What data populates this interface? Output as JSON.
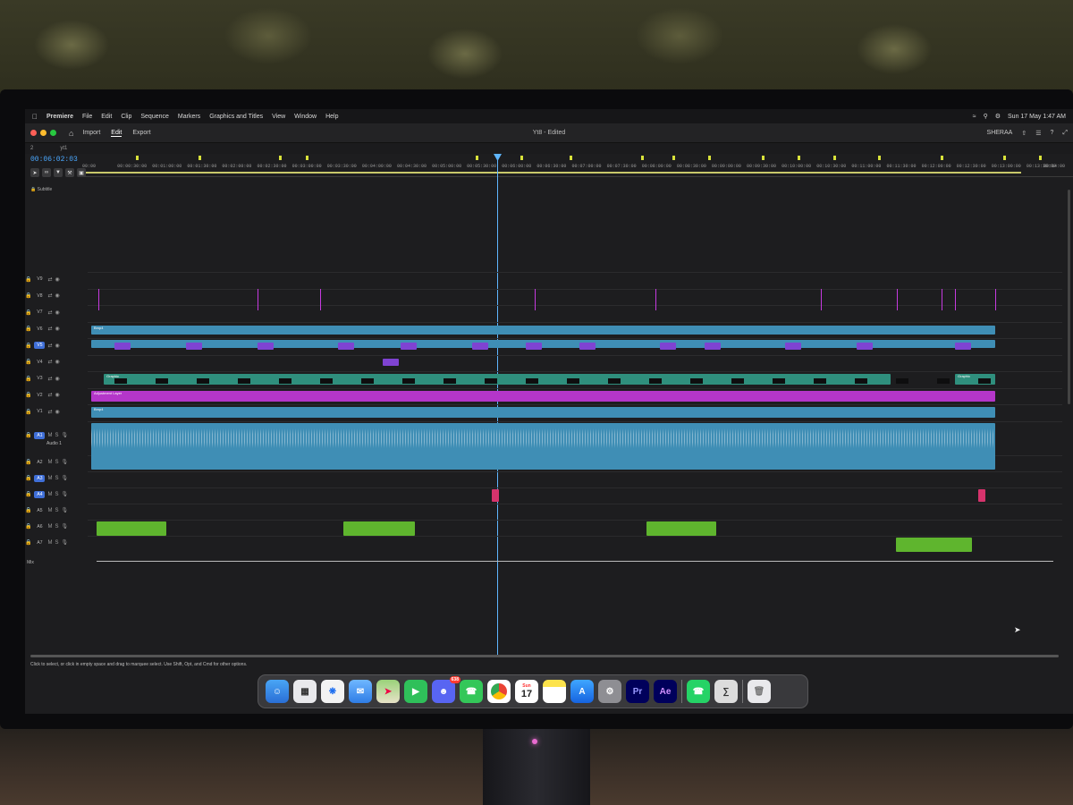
{
  "menubar": {
    "app": "Premiere",
    "items": [
      "File",
      "Edit",
      "Clip",
      "Sequence",
      "Markers",
      "Graphics and Titles",
      "View",
      "Window",
      "Help"
    ],
    "date_time": "Sun 17 May  1:47 AM",
    "user": "SHERAA"
  },
  "toolbar": {
    "workspaces": [
      "Import",
      "Edit",
      "Export"
    ],
    "active_workspace": "Edit",
    "document_title": "Yt8 - Edited"
  },
  "sequence_tabs": [
    "2",
    "yt1"
  ],
  "timecode": "00:06:02:03",
  "ruler_ticks": [
    "00:00",
    "00:00:30:00",
    "00:01:00:00",
    "00:01:30:00",
    "00:02:00:00",
    "00:02:30:00",
    "00:03:00:00",
    "00:03:30:00",
    "00:04:00:00",
    "00:04:30:00",
    "00:05:00:00",
    "00:05:30:00",
    "00:06:00:00",
    "00:06:30:00",
    "00:07:00:00",
    "00:07:30:00",
    "00:08:00:00",
    "00:08:30:00",
    "00:09:00:00",
    "00:09:30:00",
    "00:10:00:00",
    "00:10:30:00",
    "00:11:00:00",
    "00:11:30:00",
    "00:12:00:00",
    "00:12:30:00",
    "00:13:00:00",
    "00:13:30:00",
    "00:14:00"
  ],
  "subtitle_track": "Subtitle",
  "video_tracks": [
    "V9",
    "V8",
    "V7",
    "V6",
    "V5",
    "V4",
    "V3",
    "V2",
    "V1"
  ],
  "selected_video_target": "V5",
  "audio_tracks": [
    "A1",
    "A2",
    "A3",
    "A4",
    "A5",
    "A6",
    "A7"
  ],
  "audio1_label": "Audio 1",
  "mix_label": "Mix",
  "clip_labels": {
    "graphic": "Graphic",
    "adjustment": "Adjustment Layer",
    "adjustment_short": "Adjus",
    "bump": "Bmp4"
  },
  "status_bar": "Click to select, or click in empty space and drag to marquee select. Use Shift, Opt, and Cmd for other options.",
  "dock": {
    "apps": [
      "Finder",
      "Launchpad",
      "Safari",
      "Mail",
      "Maps",
      "FaceTime",
      "Discord",
      "Phone",
      "Chrome",
      "Calendar",
      "Notes",
      "App Store",
      "System Settings",
      "Premiere Pro",
      "After Effects",
      "WhatsApp",
      "Calculator",
      "Trash"
    ],
    "discord_badge": "638",
    "calendar_day": "17",
    "calendar_weekday": "Sun",
    "pr_label": "Pr",
    "ae_label": "Ae"
  },
  "colors": {
    "graphic": "#2f8f7d",
    "adjustment": "#b436c9",
    "video_blue": "#3f8eb5",
    "audio_green": "#5fb52e",
    "playhead": "#5fb6ff"
  }
}
